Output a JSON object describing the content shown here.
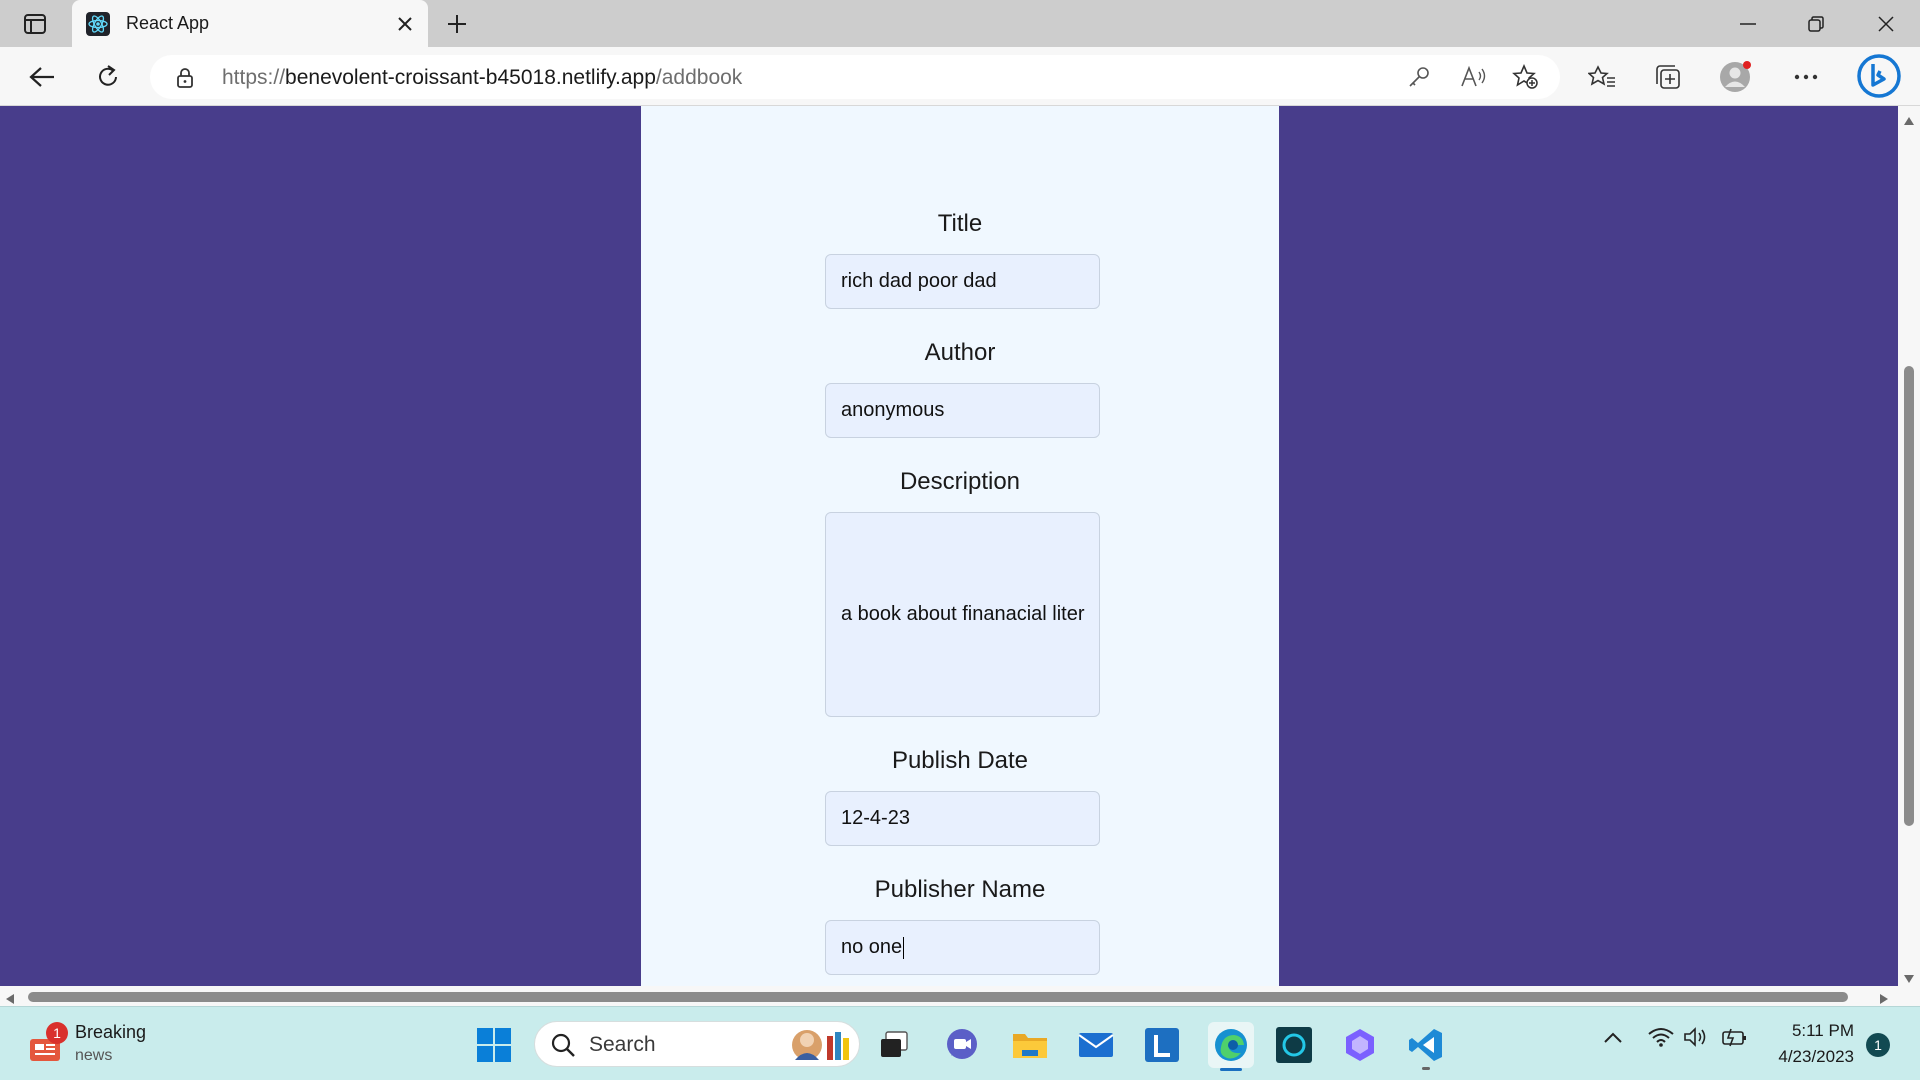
{
  "browser": {
    "tab_title": "React App",
    "url_prefix": "https://",
    "url_host": "benevolent-croissant-b45018.netlify.app",
    "url_path": "/addbook"
  },
  "form": {
    "title_label": "Title",
    "title_value": "rich dad poor dad",
    "author_label": "Author",
    "author_value": "anonymous",
    "description_label": "Description",
    "description_value": "a book about finanacial liter",
    "publish_date_label": "Publish Date",
    "publish_date_value": "12-4-23",
    "publisher_label": "Publisher Name",
    "publisher_value": "no one"
  },
  "taskbar": {
    "news_title": "Breaking",
    "news_sub": "news",
    "news_badge": "1",
    "search_placeholder": "Search",
    "time": "5:11 PM",
    "date": "4/23/2023",
    "notification_count": "1"
  },
  "colors": {
    "page_bg": "#483d8b",
    "card_bg": "#f0f8ff",
    "input_bg": "#e8f0fe"
  }
}
